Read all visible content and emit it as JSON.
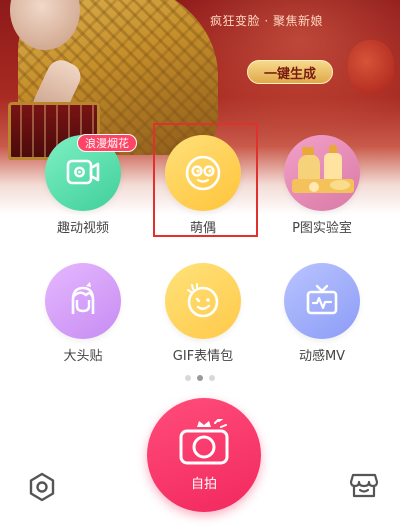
{
  "banner": {
    "subtitle": "疯狂变脸 · 聚焦新娘",
    "generate_label": "一键生成"
  },
  "features": {
    "row1": [
      {
        "label": "趣动视频",
        "badge": "浪漫烟花",
        "icon": "video-camera-icon",
        "color": "#4fd9a6"
      },
      {
        "label": "萌偶",
        "icon": "cute-face-icon",
        "color": "#ffcf4a",
        "highlighted": true
      },
      {
        "label": "P图实验室",
        "icon": "lab-jars-icon",
        "color": "#e58cb6"
      }
    ],
    "row2": [
      {
        "label": "大头贴",
        "icon": "bighead-portrait-icon",
        "color": "#d29ef6"
      },
      {
        "label": "GIF表情包",
        "icon": "gif-smiley-icon",
        "color": "#ffd35a"
      },
      {
        "label": "动感MV",
        "icon": "tv-pulse-icon",
        "color": "#9fabfa"
      }
    ]
  },
  "pager": {
    "count": 3,
    "active_index": 1
  },
  "bottom_bar": {
    "selfie_label": "自拍",
    "settings_icon": "hexagon-settings-icon",
    "store_icon": "store-icon"
  },
  "colors": {
    "accent": "#f2285e",
    "badge": "#ff4466",
    "highlight_border": "#e0312f"
  }
}
